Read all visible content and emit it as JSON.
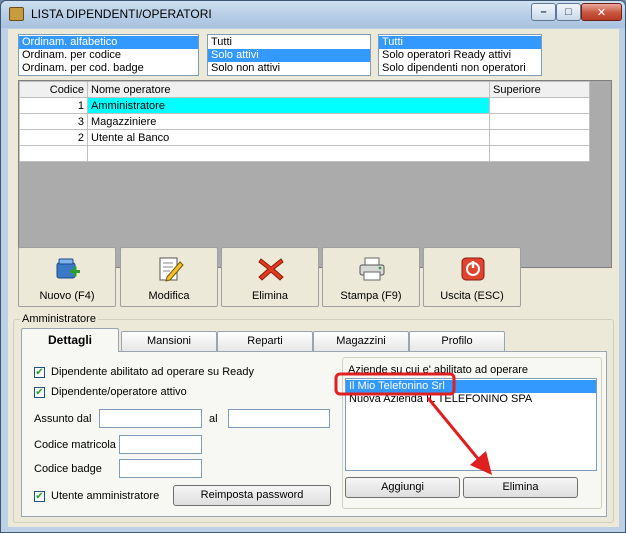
{
  "window": {
    "title": "LISTA DIPENDENTI/OPERATORI"
  },
  "controls": {
    "minimize": "–",
    "maximize": "□",
    "close": "✕"
  },
  "sort_list": {
    "items": [
      "Ordinam. alfabetico",
      "Ordinam. per codice",
      "Ordinam. per cod. badge"
    ],
    "selected_index": 0
  },
  "active_filter": {
    "items": [
      "Tutti",
      "Solo attivi",
      "Solo non attivi"
    ],
    "selected_index": 1
  },
  "type_filter": {
    "items": [
      "Tutti",
      "Solo operatori Ready attivi",
      "Solo dipendenti non operatori"
    ],
    "selected_index": 0
  },
  "grid": {
    "headers": {
      "code": "Codice",
      "name": "Nome operatore",
      "superior": "Superiore"
    },
    "rows": [
      {
        "code": "1",
        "name": "Amministratore",
        "superior": ""
      },
      {
        "code": "3",
        "name": "Magazziniere",
        "superior": ""
      },
      {
        "code": "2",
        "name": "Utente al Banco",
        "superior": ""
      },
      {
        "code": "",
        "name": "",
        "superior": ""
      }
    ],
    "active_row": 0
  },
  "toolbar": {
    "new": "Nuovo (F4)",
    "edit": "Modifica",
    "delete": "Elimina",
    "print": "Stampa (F9)",
    "exit": "Uscita (ESC)",
    "icons": [
      "new-user-icon",
      "edit-document-icon",
      "delete-x-icon",
      "printer-icon",
      "exit-power-icon"
    ]
  },
  "detail_group": {
    "legend": "Amministratore"
  },
  "tabs": [
    "Dettagli",
    "Mansioni",
    "Reparti",
    "Magazzini",
    "Profilo"
  ],
  "details": {
    "enabled_ready": "Dipendente abilitato ad operare su Ready",
    "active_operator": "Dipendente/operatore attivo",
    "hired_from": "Assunto dal",
    "hired_to": "al",
    "matricola": "Codice matricola",
    "badge": "Codice badge",
    "admin_user": "Utente amministratore",
    "reset_password": "Reimposta password",
    "checks": {
      "enabled_ready": true,
      "active_operator": true,
      "admin_user": true
    }
  },
  "companies": {
    "label": "Aziende su cui e' abilitato ad operare",
    "items": [
      "Il Mio Telefonino Srl",
      "Nuova Azienda IL TELEFONINO SPA"
    ],
    "selected_index": 0,
    "add": "Aggiungi",
    "remove": "Elimina"
  },
  "annotation": {
    "color": "#e02020"
  }
}
